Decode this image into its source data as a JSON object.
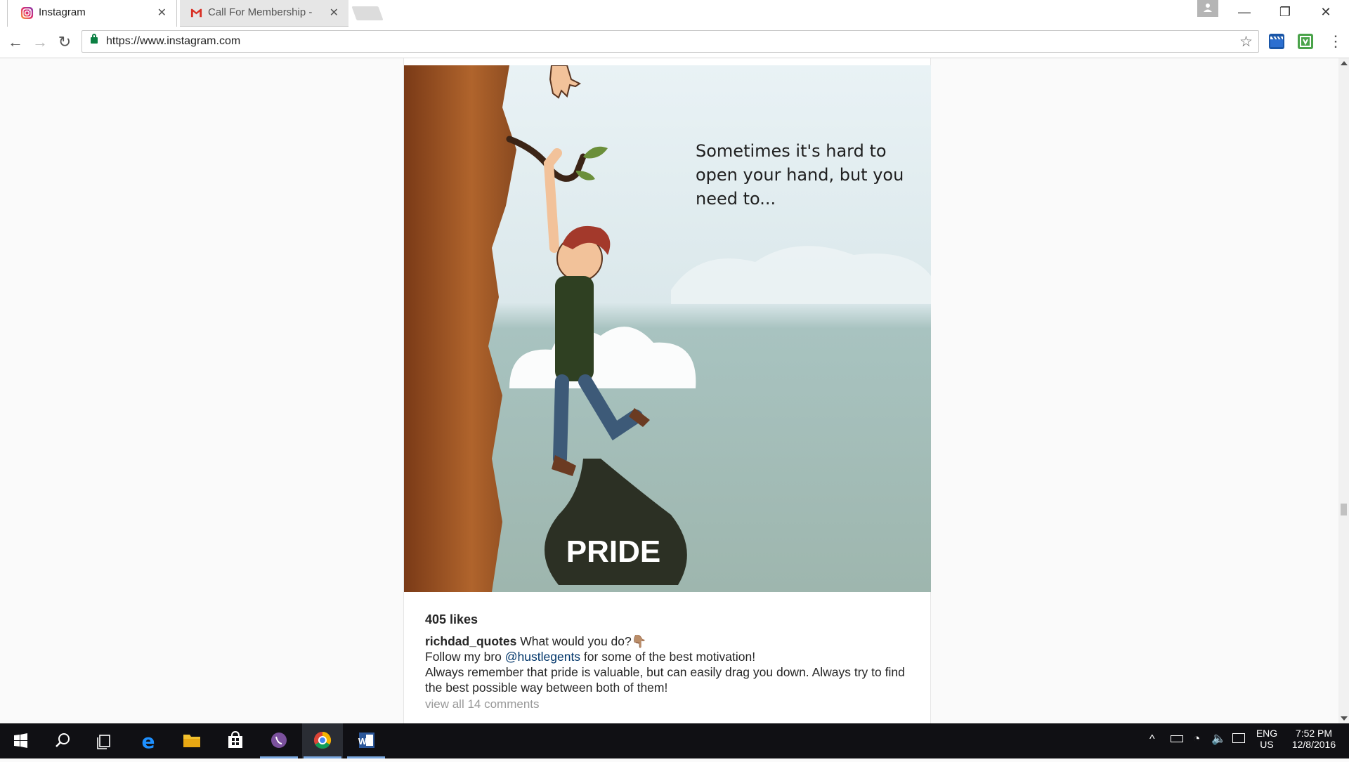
{
  "browser": {
    "tabs": [
      {
        "label": "Instagram",
        "icon": "instagram-icon"
      },
      {
        "label": "Call For Membership - D",
        "icon": "gmail-icon"
      }
    ],
    "url": "https://www.instagram.com"
  },
  "post": {
    "image_text": {
      "quote": "Sometimes it's hard to open your hand, but you need to...",
      "bag_label": "PRIDE"
    },
    "likes": "405 likes",
    "username": "richdad_quotes",
    "caption_line1": "What would you do?👇🏽",
    "caption_line2_pre": "Follow my bro ",
    "caption_mention": "@hustlegents",
    "caption_line2_post": " for some of the best motivation!",
    "caption_line3": "Always remember that pride is valuable, but can easily drag you down. Always try to find the best possible way between both of them!",
    "view_comments": "view all 14 comments"
  },
  "taskbar": {
    "language_top": "ENG",
    "language_bottom": "US",
    "time": "7:52 PM",
    "date": "12/8/2016"
  },
  "colors": {
    "accent_link": "#003569",
    "lock_green": "#0b8043",
    "taskbar_bg": "#101014"
  }
}
